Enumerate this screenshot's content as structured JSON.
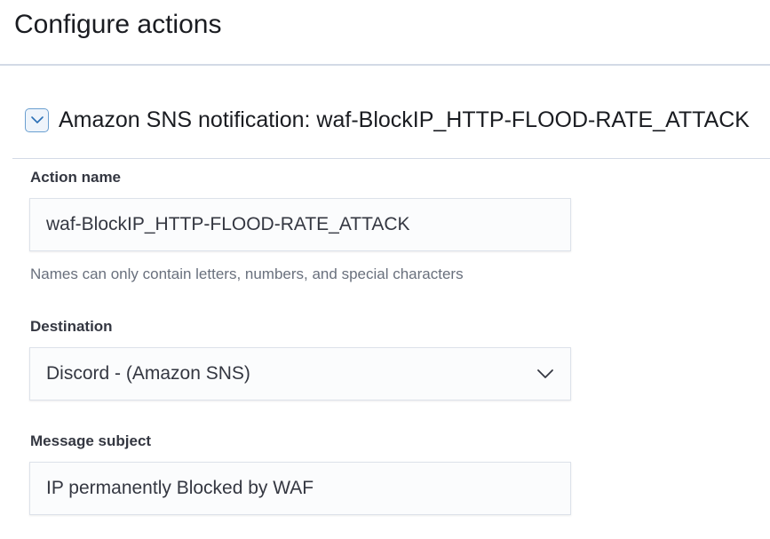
{
  "page": {
    "title": "Configure actions"
  },
  "action": {
    "header_title": "Amazon SNS notification: waf-BlockIP_HTTP-FLOOD-RATE_ATTACK",
    "expand_icon": "chevron-down-icon",
    "fields": {
      "action_name": {
        "label": "Action name",
        "value": "waf-BlockIP_HTTP-FLOOD-RATE_ATTACK",
        "help": "Names can only contain letters, numbers, and special characters"
      },
      "destination": {
        "label": "Destination",
        "value": "Discord - (Amazon SNS)",
        "icon": "chevron-down-icon"
      },
      "message_subject": {
        "label": "Message subject",
        "value": "IP permanently Blocked by WAF"
      }
    }
  },
  "colors": {
    "accent": "#6a9fd0",
    "divider": "#d3dae6",
    "field_background": "#fbfcfd",
    "help_text": "#69707d"
  }
}
